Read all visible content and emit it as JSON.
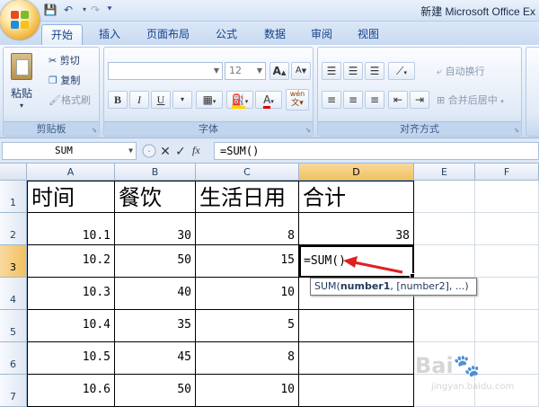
{
  "window": {
    "title": "新建 Microsoft Office Ex"
  },
  "ribbon_tabs": [
    "开始",
    "插入",
    "页面布局",
    "公式",
    "数据",
    "审阅",
    "视图"
  ],
  "clipboard": {
    "paste": "粘贴",
    "cut": "剪切",
    "copy": "复制",
    "format_painter": "格式刷",
    "group_label": "剪贴板"
  },
  "font": {
    "font_size": "12",
    "group_label": "字体",
    "bold": "B",
    "italic": "I",
    "underline": "U",
    "grow": "A",
    "shrink": "A",
    "font_color_letter": "A",
    "phonetic": "wén"
  },
  "alignment": {
    "wrap_text": "自动换行",
    "merge_center": "合并后居中",
    "group_label": "对齐方式"
  },
  "formula_bar": {
    "name_box": "SUM",
    "formula": "=SUM()",
    "fx": "fx"
  },
  "columns": [
    "A",
    "B",
    "C",
    "D",
    "E",
    "F"
  ],
  "rows": [
    "1",
    "2",
    "3",
    "4",
    "5",
    "6",
    "7"
  ],
  "table": {
    "headers": [
      "时间",
      "餐饮",
      "生活日用",
      "合计"
    ],
    "rows": [
      [
        "10.1",
        "30",
        "8",
        "38"
      ],
      [
        "10.2",
        "50",
        "15",
        "=SUM()"
      ],
      [
        "10.3",
        "40",
        "10",
        ""
      ],
      [
        "10.4",
        "35",
        "5",
        ""
      ],
      [
        "10.5",
        "45",
        "8",
        ""
      ],
      [
        "10.6",
        "50",
        "10",
        ""
      ]
    ]
  },
  "tooltip": {
    "fn": "SUM(",
    "arg1": "number1",
    "rest": ", [number2], ...)"
  },
  "watermark": {
    "main": "Bai",
    "sub": "jingyan.baidu.com"
  },
  "colors": {
    "accent": "#15428b",
    "selected_header": "#f1c15f",
    "arrow": "#e02020"
  }
}
